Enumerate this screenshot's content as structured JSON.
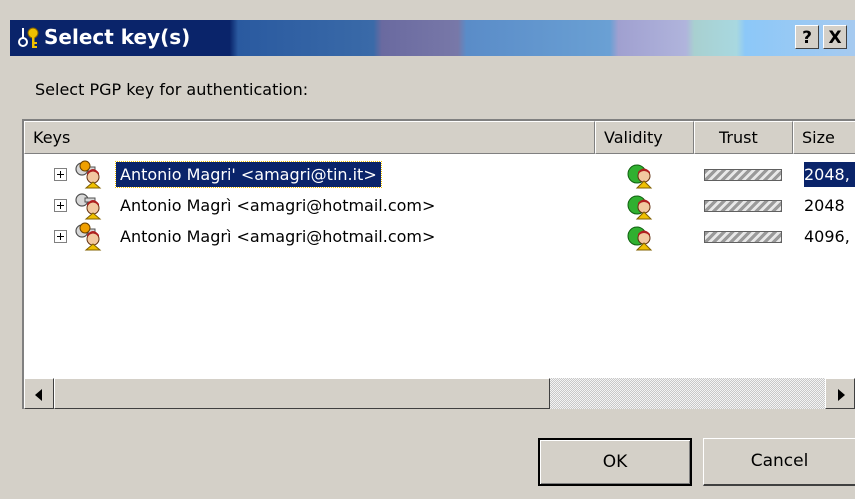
{
  "window": {
    "title": "Select key(s)",
    "help_label": "?",
    "close_label": "X"
  },
  "prompt": "Select PGP key for authentication:",
  "columns": [
    "Keys",
    "Validity",
    "Trust",
    "Size"
  ],
  "keys": [
    {
      "name": "Antonio Magri' <amagri@tin.it>",
      "size": "2048,",
      "selected": true,
      "validity_icon": "valid-key-icon",
      "trust": "trust-bar"
    },
    {
      "name": "Antonio Magrì <amagri@hotmail.com>",
      "size": "2048",
      "selected": false,
      "validity_icon": "valid-key-icon",
      "trust": "trust-bar"
    },
    {
      "name": "Antonio Magrì <amagri@hotmail.com>",
      "size": "4096,",
      "selected": false,
      "validity_icon": "valid-key-icon",
      "trust": "trust-bar"
    }
  ],
  "buttons": {
    "ok": "OK",
    "cancel": "Cancel"
  },
  "colors": {
    "selection": "#0a246a",
    "face": "#d4d0c8",
    "title_bar": "#0a246a"
  }
}
